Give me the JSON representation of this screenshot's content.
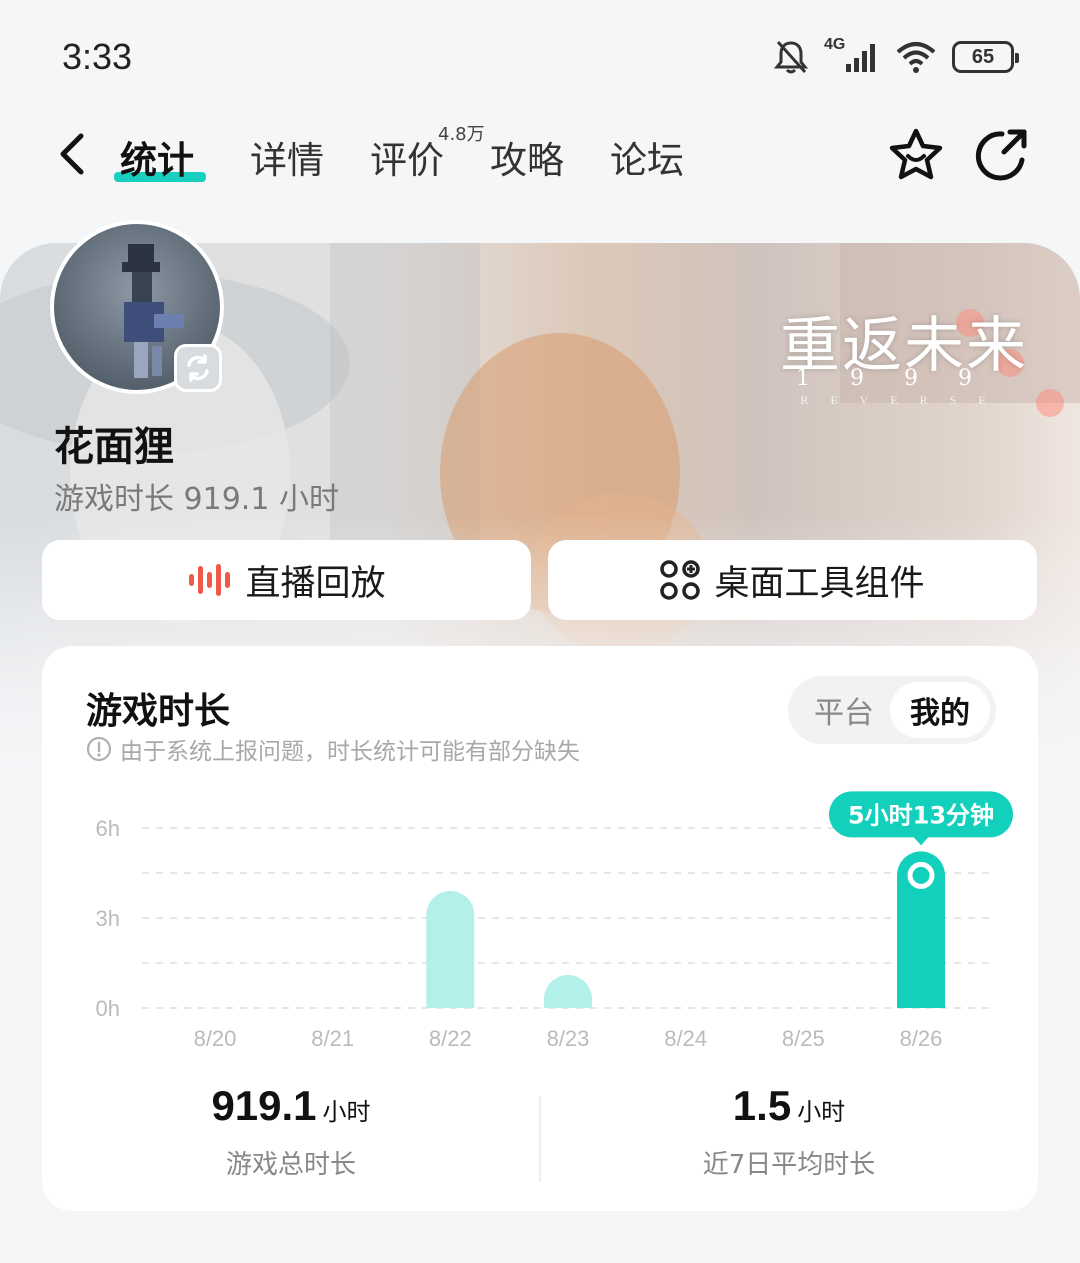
{
  "status_bar": {
    "time": "3:33",
    "network": "4G",
    "battery": "65",
    "icons": [
      "mute-bell-icon",
      "signal-icon",
      "wifi-icon",
      "battery-icon"
    ]
  },
  "nav": {
    "tabs": [
      {
        "label": "统计",
        "active": true
      },
      {
        "label": "详情",
        "active": false
      },
      {
        "label": "评价",
        "active": false
      },
      {
        "label": "攻略",
        "active": false
      },
      {
        "label": "论坛",
        "active": false
      }
    ],
    "rating_badge": "4.8万",
    "icons": [
      "back-icon",
      "star-icon",
      "share-icon"
    ],
    "accent_color": "#19d0c0"
  },
  "profile": {
    "game_logo": "重返未来",
    "game_logo_sub": "1999",
    "game_logo_en": "REVERSE",
    "username": "花面狸",
    "playtime_label": "游戏时长 919.1 小时"
  },
  "actions": {
    "live_replay": "直播回放",
    "desktop_widget": "桌面工具组件"
  },
  "card": {
    "title": "游戏时长",
    "note": "由于系统上报问题，时长统计可能有部分缺失",
    "toggle": {
      "platform": "平台",
      "mine": "我的",
      "selected": "我的"
    },
    "tooltip": "5小时13分钟",
    "total": {
      "value": "919.1",
      "unit": "小时",
      "label": "游戏总时长"
    },
    "average": {
      "value": "1.5",
      "unit": "小时",
      "label": "近7日平均时长"
    }
  },
  "chart_data": {
    "type": "bar",
    "categories": [
      "8/20",
      "8/21",
      "8/22",
      "8/23",
      "8/24",
      "8/25",
      "8/26"
    ],
    "values": [
      0,
      0,
      3.9,
      1.1,
      0,
      0,
      5.22
    ],
    "y_ticks": [
      "0h",
      "3h",
      "6h"
    ],
    "ylim": [
      0,
      6
    ],
    "gridlines": [
      0,
      1.5,
      3,
      4.5,
      6
    ],
    "highlight_index": 6,
    "bar_color": "#b3f0ea",
    "highlight_color": "#13d0bd"
  }
}
